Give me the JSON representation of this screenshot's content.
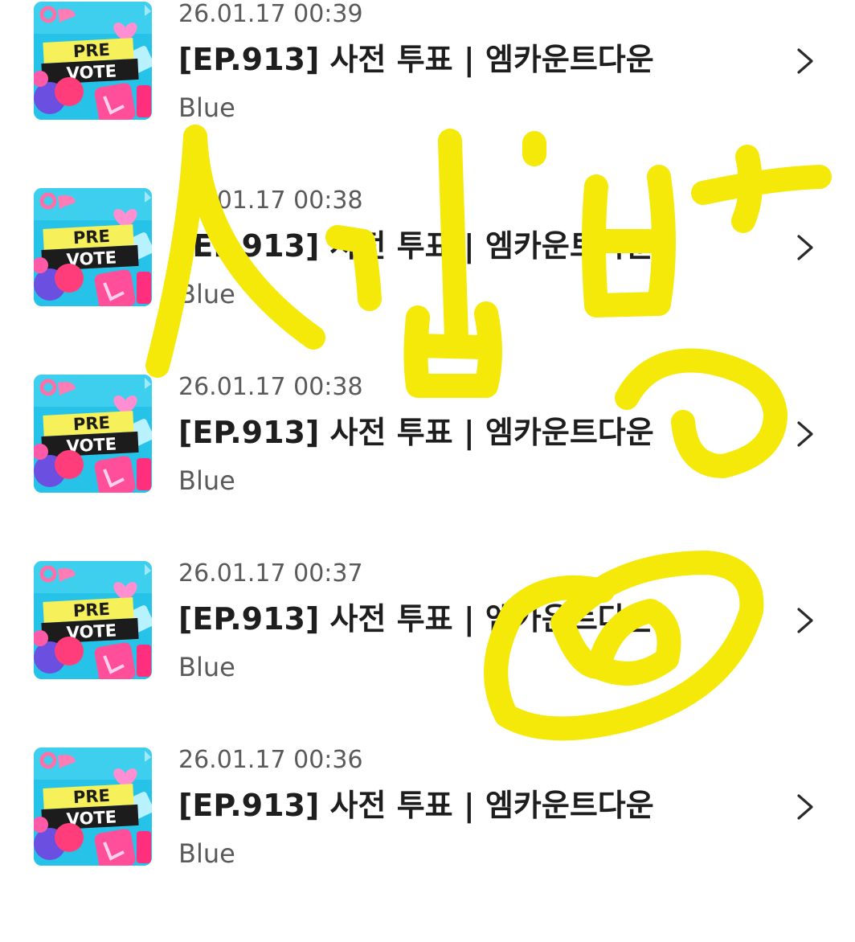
{
  "items": [
    {
      "time": "26.01.17 00:39",
      "title": "[EP.913] 사전 투표 | 엠카운트다운",
      "artist": "Blue",
      "thumb_line1": "PRE",
      "thumb_line2": "VOTE"
    },
    {
      "time": "26.01.17 00:38",
      "title": "[EP.913] 사전 투표 | 엠카운트다운",
      "artist": "Blue",
      "thumb_line1": "PRE",
      "thumb_line2": "VOTE"
    },
    {
      "time": "26.01.17 00:38",
      "title": "[EP.913] 사전 투표 | 엠카운트다운",
      "artist": "Blue",
      "thumb_line1": "PRE",
      "thumb_line2": "VOTE"
    },
    {
      "time": "26.01.17 00:37",
      "title": "[EP.913] 사전 투표 | 엠카운트다운",
      "artist": "Blue",
      "thumb_line1": "PRE",
      "thumb_line2": "VOTE"
    },
    {
      "time": "26.01.17 00:36",
      "title": "[EP.913] 사전 투표 | 엠카운트다운",
      "artist": "Blue",
      "thumb_line1": "PRE",
      "thumb_line2": "VOTE"
    }
  ],
  "icons": {
    "chevron": "chevron-right-icon",
    "thumbnail": "pre-vote-thumbnail"
  },
  "colors": {
    "scribble": "#f5e90a",
    "title_text": "#1e1e1e",
    "meta_text": "#5a5a5a",
    "thumb_background": "#27c2e8",
    "thumb_banner": "#f6f05a",
    "thumb_accent": "#ff4f9a"
  }
}
